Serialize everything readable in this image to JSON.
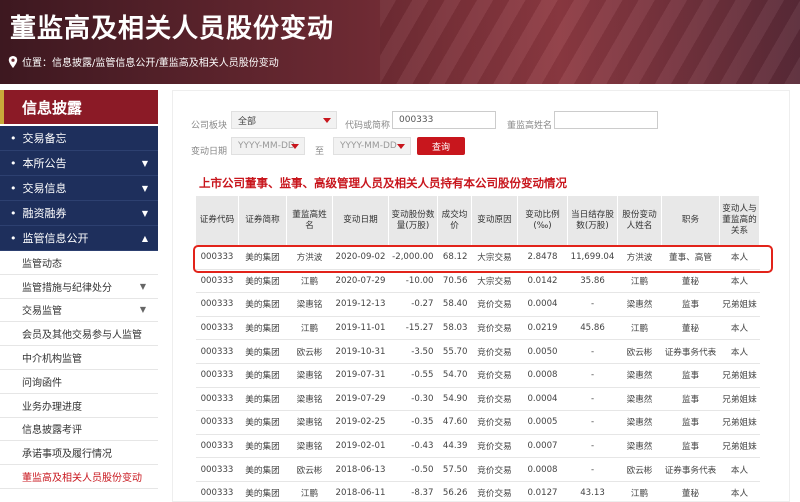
{
  "header": {
    "title": "董监高及相关人员股份变动",
    "breadcrumb": "位置：信息披露/监管信息公开/董监高及相关人员股份变动"
  },
  "sidebar": {
    "heading": "信息披露",
    "items": [
      {
        "label": "交易备忘",
        "caret": ""
      },
      {
        "label": "本所公告",
        "caret": "▼"
      },
      {
        "label": "交易信息",
        "caret": "▼"
      },
      {
        "label": "融资融券",
        "caret": "▼"
      },
      {
        "label": "监管信息公开",
        "caret": "▲"
      }
    ],
    "sub_items": [
      {
        "label": "监管动态",
        "caret": ""
      },
      {
        "label": "监管措施与纪律处分",
        "caret": "▼"
      },
      {
        "label": "交易监管",
        "caret": "▼"
      },
      {
        "label": "会员及其他交易参与人监管",
        "caret": ""
      },
      {
        "label": "中介机构监管",
        "caret": ""
      },
      {
        "label": "问询函件",
        "caret": ""
      },
      {
        "label": "业务办理进度",
        "caret": ""
      },
      {
        "label": "信息披露考评",
        "caret": ""
      },
      {
        "label": "承诺事项及履行情况",
        "caret": ""
      },
      {
        "label": "董监高及相关人员股份变动",
        "caret": ""
      }
    ]
  },
  "filters": {
    "board_label": "公司板块",
    "board_value": "全部",
    "code_label": "代码或简称",
    "code_value": "000333",
    "name_label": "董监高姓名",
    "name_value": "",
    "date_label": "变动日期",
    "date_from_placeholder": "YYYY-MM-DD",
    "date_to_label": "至",
    "date_to_placeholder": "YYYY-MM-DD",
    "query_label": "查询"
  },
  "section_title": "上市公司董事、监事、高级管理人员及相关人员持有本公司股份变动情况",
  "table": {
    "headers": [
      "证券代码",
      "证券简称",
      "董监高姓名",
      "变动日期",
      "变动股份数量(万股)",
      "成交均价",
      "变动原因",
      "变动比例(‰)",
      "当日结存股数(万股)",
      "股份变动人姓名",
      "职务",
      "变动人与董监高的关系"
    ],
    "rows": [
      [
        "000333",
        "美的集团",
        "方洪波",
        "2020-09-02",
        "-2,000.00",
        "68.12",
        "大宗交易",
        "2.8478",
        "11,699.04",
        "方洪波",
        "董事、高管",
        "本人"
      ],
      [
        "000333",
        "美的集团",
        "江鹏",
        "2020-07-29",
        "-10.00",
        "70.56",
        "大宗交易",
        "0.0142",
        "35.86",
        "江鹏",
        "董秘",
        "本人"
      ],
      [
        "000333",
        "美的集团",
        "梁惠铭",
        "2019-12-13",
        "-0.27",
        "58.40",
        "竞价交易",
        "0.0004",
        "-",
        "梁惠然",
        "监事",
        "兄弟姐妹"
      ],
      [
        "000333",
        "美的集团",
        "江鹏",
        "2019-11-01",
        "-15.27",
        "58.03",
        "竞价交易",
        "0.0219",
        "45.86",
        "江鹏",
        "董秘",
        "本人"
      ],
      [
        "000333",
        "美的集团",
        "欧云彬",
        "2019-10-31",
        "-3.50",
        "55.70",
        "竞价交易",
        "0.0050",
        "-",
        "欧云彬",
        "证券事务代表",
        "本人"
      ],
      [
        "000333",
        "美的集团",
        "梁惠铭",
        "2019-07-31",
        "-0.55",
        "54.70",
        "竞价交易",
        "0.0008",
        "-",
        "梁惠然",
        "监事",
        "兄弟姐妹"
      ],
      [
        "000333",
        "美的集团",
        "梁惠铭",
        "2019-07-29",
        "-0.30",
        "54.90",
        "竞价交易",
        "0.0004",
        "-",
        "梁惠然",
        "监事",
        "兄弟姐妹"
      ],
      [
        "000333",
        "美的集团",
        "梁惠铭",
        "2019-02-25",
        "-0.35",
        "47.60",
        "竞价交易",
        "0.0005",
        "-",
        "梁惠然",
        "监事",
        "兄弟姐妹"
      ],
      [
        "000333",
        "美的集团",
        "梁惠铭",
        "2019-02-01",
        "-0.43",
        "44.39",
        "竞价交易",
        "0.0007",
        "-",
        "梁惠然",
        "监事",
        "兄弟姐妹"
      ],
      [
        "000333",
        "美的集团",
        "欧云彬",
        "2018-06-13",
        "-0.50",
        "57.50",
        "竞价交易",
        "0.0008",
        "-",
        "欧云彬",
        "证券事务代表",
        "本人"
      ],
      [
        "000333",
        "美的集团",
        "江鹏",
        "2018-06-11",
        "-8.37",
        "56.26",
        "竞价交易",
        "0.0127",
        "43.13",
        "江鹏",
        "董秘",
        "本人"
      ]
    ]
  },
  "colors": {
    "banner": "#6d2a33",
    "sidebar_nav": "#1e2f5c",
    "accent_red": "#c8161d"
  }
}
